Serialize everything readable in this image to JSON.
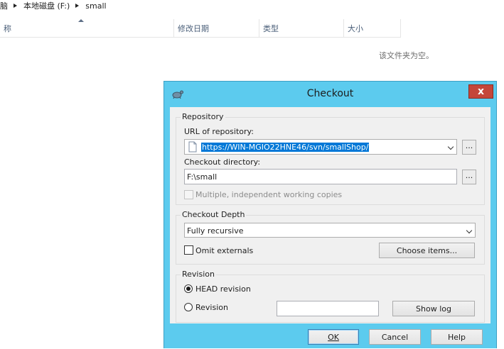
{
  "explorer": {
    "breadcrumb": [
      "脑",
      "本地磁盘 (F:)",
      "small"
    ],
    "columns": [
      "称",
      "修改日期",
      "类型",
      "大小"
    ],
    "empty_message": "该文件夹为空。"
  },
  "dialog": {
    "title": "Checkout",
    "close_symbol": "x",
    "repository": {
      "group_label": "Repository",
      "url_label": "URL of repository:",
      "url_value": "https://WIN-MGIO22HNE46/svn/smallShop/",
      "browse_label": "...",
      "dir_label": "Checkout directory:",
      "dir_value": "F:\\small",
      "dir_browse_label": "...",
      "multiple_label": "Multiple, independent working copies",
      "multiple_checked": false
    },
    "depth": {
      "group_label": "Checkout Depth",
      "selected": "Fully recursive",
      "omit_externals_label": "Omit externals",
      "omit_externals_checked": false,
      "choose_items_label": "Choose items..."
    },
    "revision": {
      "group_label": "Revision",
      "head_label": "HEAD revision",
      "revision_label": "Revision",
      "selected": "head",
      "revision_value": "",
      "show_log_label": "Show log"
    },
    "buttons": {
      "ok": "OK",
      "cancel": "Cancel",
      "help": "Help"
    }
  },
  "colors": {
    "frame": "#5ccbee",
    "close": "#c5463a",
    "selection": "#0078d7"
  }
}
